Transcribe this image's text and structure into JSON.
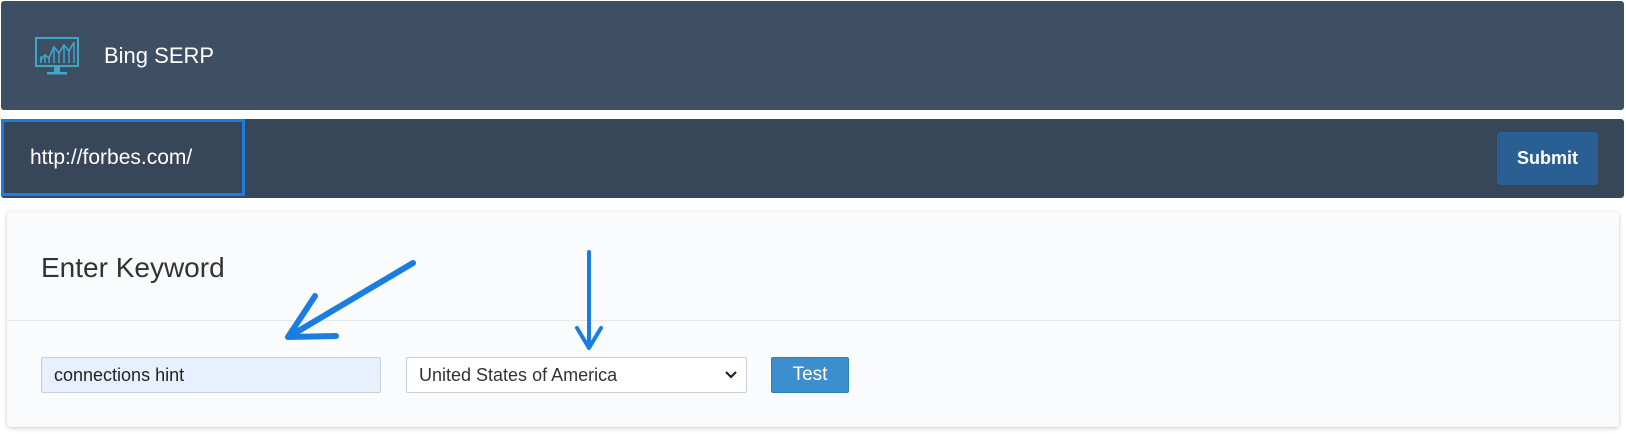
{
  "header": {
    "title": "Bing SERP",
    "logo_icon": "monitor-chart-icon"
  },
  "url_bar": {
    "value": "http://forbes.com/",
    "submit_label": "Submit"
  },
  "keyword_panel": {
    "title": "Enter Keyword",
    "keyword_value": "connections hint",
    "country_selected": "United States of America",
    "test_label": "Test"
  },
  "annotations": {
    "arrow_color": "#1a7de0",
    "items": [
      "arrow-to-keyword-input-icon",
      "arrow-to-country-select-icon"
    ]
  },
  "colors": {
    "header_bg": "#3e4f64",
    "url_bar_bg": "#374659",
    "submit_bg": "#2a5f93",
    "test_bg": "#3c8fcc",
    "highlight": "#1a7de0"
  }
}
